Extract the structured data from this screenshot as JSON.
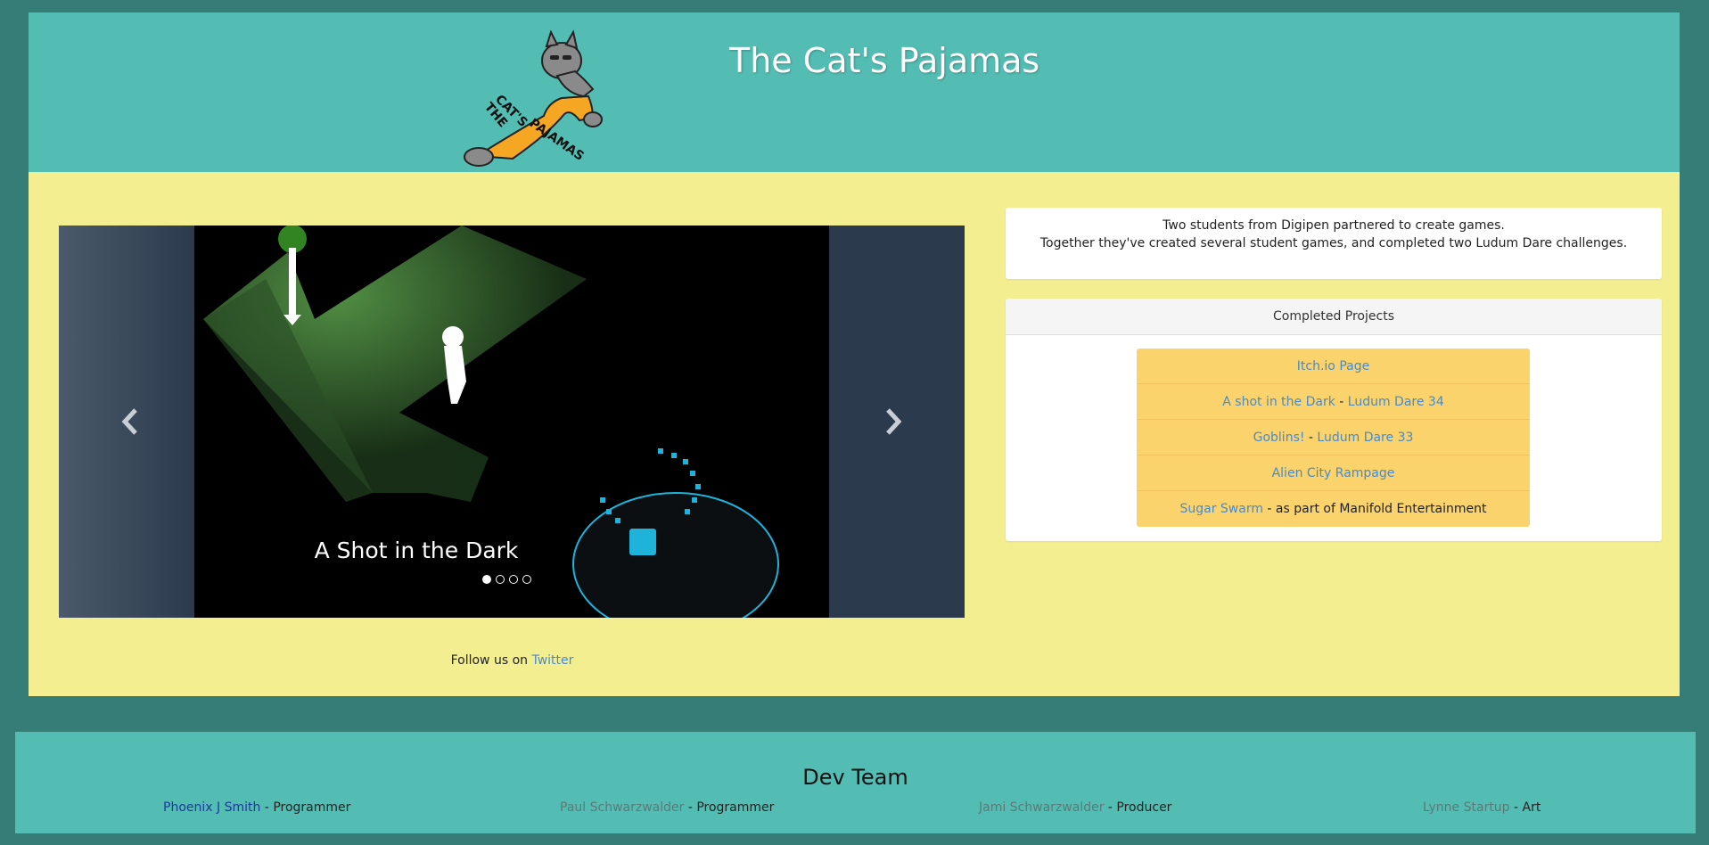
{
  "header": {
    "title": "The Cat's Pajamas",
    "logo_text_line1": "THE",
    "logo_text_line2": "CAT'S",
    "logo_text_line3": "PAJAMAS"
  },
  "carousel": {
    "caption": "A Shot in the Dark",
    "active_index": 0,
    "slide_count": 4,
    "prev_icon": "chevron-left-icon",
    "next_icon": "chevron-right-icon"
  },
  "about": {
    "line1": "Two students from Digipen partnered to create games.",
    "line2": "Together they've created several student games, and completed two Ludum Dare challenges."
  },
  "projects": {
    "heading": "Completed Projects",
    "items": [
      {
        "link": "Itch.io Page",
        "sep": "",
        "extra": "",
        "extra_is_link": false
      },
      {
        "link": "A shot in the Dark",
        "sep": " - ",
        "extra": "Ludum Dare 34",
        "extra_is_link": true
      },
      {
        "link": "Goblins!",
        "sep": " - ",
        "extra": "Ludum Dare 33",
        "extra_is_link": true
      },
      {
        "link": "Alien City Rampage",
        "sep": "",
        "extra": "",
        "extra_is_link": false
      },
      {
        "link": "Sugar Swarm",
        "sep": " - ",
        "extra": "as part of Manifold Entertainment",
        "extra_is_link": false
      }
    ]
  },
  "follow": {
    "text": "Follow us on ",
    "link": "Twitter"
  },
  "footer": {
    "title": "Dev Team",
    "members": [
      {
        "name": "Phoenix J Smith",
        "role": "Programmer"
      },
      {
        "name": "Paul Schwarzwalder",
        "role": "Programmer"
      },
      {
        "name": "Jami Schwarzwalder",
        "role": "Producer"
      },
      {
        "name": "Lynne Startup",
        "role": "Art"
      }
    ]
  },
  "colors": {
    "background": "#377d77",
    "header": "#53bdb3",
    "main": "#f3ef91",
    "project_item": "#fad36c",
    "link": "#4a8ac9"
  }
}
